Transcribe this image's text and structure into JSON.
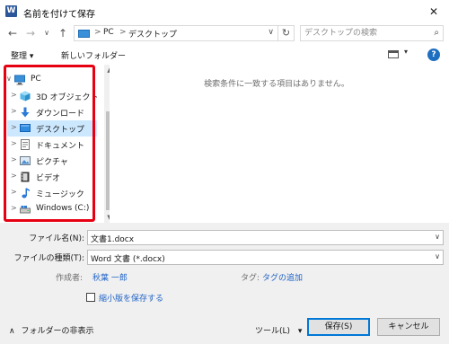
{
  "window": {
    "title": "名前を付けて保存",
    "app_icon_letter": "W",
    "close_glyph": "✕"
  },
  "navigation": {
    "back_glyph": "←",
    "forward_glyph": "→",
    "dropdown_glyph": "∨",
    "up_glyph": "↑",
    "address_segments": [
      "PC",
      "デスクトップ"
    ],
    "address_separator": ">",
    "address_caret": "∨",
    "refresh_glyph": "↻",
    "search_placeholder": "デスクトップの検索",
    "search_glyph": "⌕"
  },
  "toolbar": {
    "organize_label": "整理 ▾",
    "new_folder_label": "新しいフォルダー",
    "view_dropdown_glyph": "▾",
    "help_glyph": "?"
  },
  "sidebar": {
    "items": [
      {
        "label": "PC",
        "icon": "computer-icon",
        "expanded": true
      },
      {
        "label": "3D オブジェクト",
        "icon": "cube-icon"
      },
      {
        "label": "ダウンロード",
        "icon": "download-arrow-icon"
      },
      {
        "label": "デスクトップ",
        "icon": "desktop-icon",
        "selected": true
      },
      {
        "label": "ドキュメント",
        "icon": "document-icon"
      },
      {
        "label": "ピクチャ",
        "icon": "picture-icon"
      },
      {
        "label": "ビデオ",
        "icon": "video-icon"
      },
      {
        "label": "ミュージック",
        "icon": "music-note-icon"
      },
      {
        "label": "Windows (C:)",
        "icon": "drive-icon"
      }
    ],
    "expand_glyph": ">",
    "collapse_glyph": "∨",
    "scroll_up_glyph": "▲",
    "scroll_down_glyph": "▼",
    "highlight_color": "#e60012"
  },
  "main": {
    "empty_message": "検索条件に一致する項目はありません。"
  },
  "form": {
    "filename_label": "ファイル名(N):",
    "filename_value": "文書1.docx",
    "filetype_label": "ファイルの種類(T):",
    "filetype_value": "Word 文書 (*.docx)",
    "author_label": "作成者:",
    "author_value": "秋葉 一郎",
    "tags_label": "タグ:",
    "tags_value": "タグの追加",
    "thumbnail_label": "縮小版を保存する",
    "combo_arrow": "∨"
  },
  "footer": {
    "hide_folders_label": "フォルダーの非表示",
    "hide_folders_glyph": "∧",
    "tools_label": "ツール(L)",
    "tools_caret": "▾",
    "save_label": "保存(S)",
    "cancel_label": "キャンセル"
  },
  "colors": {
    "accent": "#0078d7",
    "link": "#1f63c6",
    "selection": "#cce8ff"
  }
}
